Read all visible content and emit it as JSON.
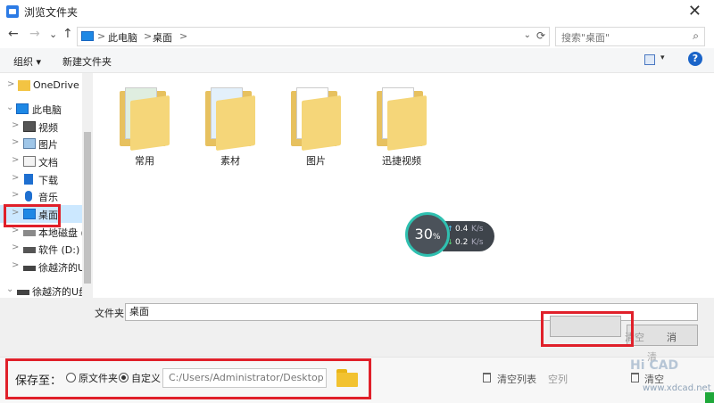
{
  "window": {
    "title": "浏览文件夹",
    "close": "✕"
  },
  "nav": {
    "back": "←",
    "forward": "→",
    "dropdown": "⌄",
    "up": "↑"
  },
  "address": {
    "crumbs": [
      "此电脑",
      "桌面"
    ],
    "sep": ">",
    "dropdown": "⌄",
    "refresh": "⟳"
  },
  "search": {
    "placeholder": "搜索\"桌面\"",
    "icon": "⌕"
  },
  "toolbar": {
    "organize": "组织 ▾",
    "new_folder": "新建文件夹",
    "view_dd": "▾",
    "help": "?"
  },
  "sidebar": {
    "items": [
      {
        "label": "OneDrive",
        "icon": "folder-icon",
        "chev": ">"
      },
      {
        "label": "此电脑",
        "icon": "pc-icon",
        "chev": "⌄"
      },
      {
        "label": "视频",
        "icon": "video-icon",
        "chev": ">"
      },
      {
        "label": "图片",
        "icon": "picture-icon",
        "chev": ">"
      },
      {
        "label": "文档",
        "icon": "document-icon",
        "chev": ">"
      },
      {
        "label": "下载",
        "icon": "download-icon",
        "chev": ">"
      },
      {
        "label": "音乐",
        "icon": "music-icon",
        "chev": ">"
      },
      {
        "label": "桌面",
        "icon": "desktop-icon",
        "chev": ">"
      },
      {
        "label": "本地磁盘 (C",
        "icon": "drive-icon",
        "chev": ">"
      },
      {
        "label": "软件 (D:)",
        "icon": "drive-icon",
        "chev": ">"
      },
      {
        "label": "徐越济的U盘",
        "icon": "usb-icon",
        "chev": ">"
      },
      {
        "label": "徐越济的U盘",
        "icon": "usb-icon",
        "chev": "⌄"
      }
    ]
  },
  "folders": [
    "常用",
    "素材",
    "图片",
    "迅捷视频"
  ],
  "speed": {
    "percent": "30",
    "unit": "%",
    "up": "0.4",
    "down": "0.2",
    "rate_unit": "K/s",
    "up_arrow": "↑",
    "down_arrow": "↓"
  },
  "filename": {
    "label": "文件夹:",
    "value": "桌面"
  },
  "buttons": {
    "clear_partial": "清空",
    "cancel_partial": "消"
  },
  "save": {
    "label": "保存至：",
    "option_original": "原文件夹",
    "option_custom": "自定义",
    "path": "C:/Users/Administrator/Desktop"
  },
  "bottom": {
    "clear_list": "清空列表",
    "clear_list_partial": "空列",
    "clear_partial": "清空",
    "clear_faded": "清",
    "watermark1": "Hi CAD",
    "watermark2": "www.xdcad.net"
  },
  "colors": {
    "highlight": "#e0202a",
    "selection": "#cce8ff",
    "folder": "#f5d679",
    "accent": "#2fc0b0"
  }
}
